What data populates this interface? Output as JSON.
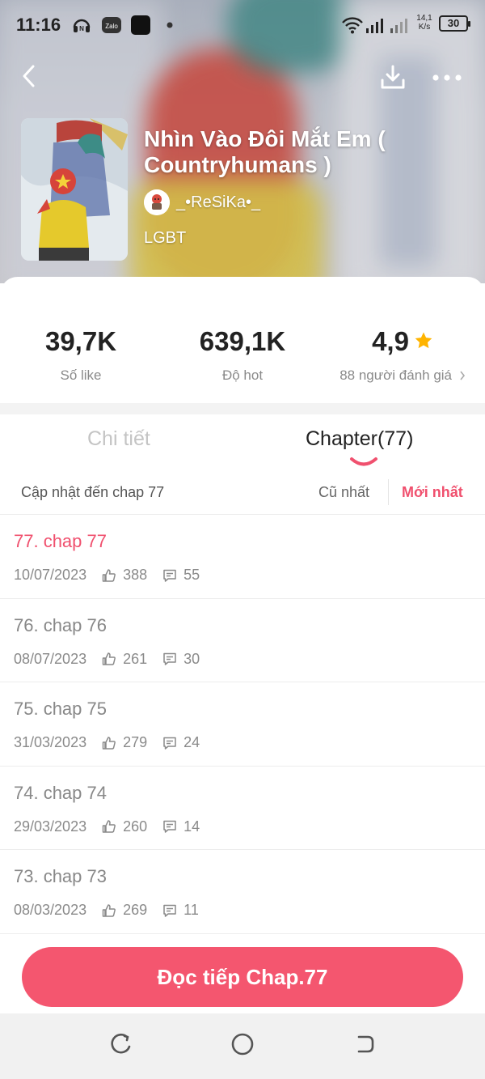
{
  "status_bar": {
    "time": "11:16",
    "net_speed_value": "14,1",
    "net_speed_unit": "K/s",
    "battery": "30",
    "icons": [
      "headset-icon",
      "zalo-icon",
      "app-icon",
      "dot-icon",
      "wifi-icon",
      "signal-icon",
      "signal-icon-2"
    ]
  },
  "header": {
    "back_icon": "chevron-left-icon",
    "download_icon": "download-icon",
    "more_icon": "more-icon"
  },
  "story": {
    "title": "Nhìn Vào Đôi Mắt Em ( Countryhumans )",
    "author": "_•ReSiKa•_",
    "genre": "LGBT"
  },
  "stats": {
    "likes": {
      "value": "39,7K",
      "label": "Số like"
    },
    "hot": {
      "value": "639,1K",
      "label": "Độ hot"
    },
    "rating": {
      "value": "4,9",
      "label": "88 người đánh giá"
    }
  },
  "tabs": {
    "detail": "Chi tiết",
    "chapter": "Chapter(77)",
    "active": "chapter"
  },
  "sort": {
    "update_text": "Cập nhật đến chap 77",
    "oldest": "Cũ nhất",
    "newest": "Mới nhất",
    "active": "newest"
  },
  "chapters": [
    {
      "title": "77. chap 77",
      "date": "10/07/2023",
      "likes": "388",
      "comments": "55",
      "active": true
    },
    {
      "title": "76. chap 76",
      "date": "08/07/2023",
      "likes": "261",
      "comments": "30"
    },
    {
      "title": "75. chap 75",
      "date": "31/03/2023",
      "likes": "279",
      "comments": "24"
    },
    {
      "title": "74. chap 74",
      "date": "29/03/2023",
      "likes": "260",
      "comments": "14"
    },
    {
      "title": "73. chap 73",
      "date": "08/03/2023",
      "likes": "269",
      "comments": "11"
    }
  ],
  "cta": {
    "label": "Đọc tiếp Chap.77"
  },
  "colors": {
    "accent": "#f4566f",
    "accent_text": "#f0506e",
    "star": "#ffb400"
  },
  "nav": {
    "icons": [
      "recents-icon",
      "home-icon",
      "back-icon"
    ]
  }
}
